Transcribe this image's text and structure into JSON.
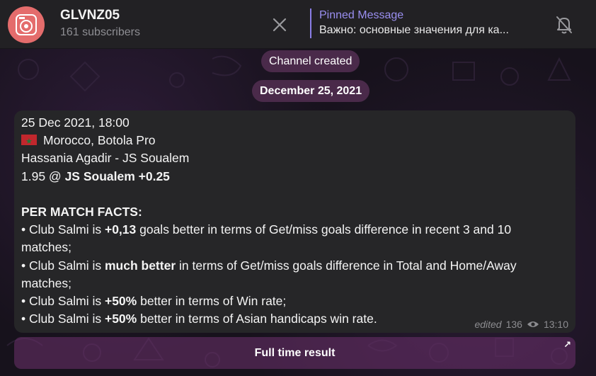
{
  "header": {
    "channel_name": "GLVNZ05",
    "subscribers": "161 subscribers",
    "pinned_title": "Pinned Message",
    "pinned_text": "Важно: основные значения для ка..."
  },
  "service": {
    "created": "Channel created",
    "date": "December 25, 2021"
  },
  "message": {
    "line1": "25 Dec 2021, 18:00",
    "line2": "Morocco, Botola Pro",
    "line3": "Hassania Agadir - JS Soualem",
    "line4_prefix": "1.95 @ ",
    "line4_bold": "JS Soualem +0.25",
    "facts_title": "PER MATCH FACTS:",
    "f1_a": "• Club Salmi is ",
    "f1_b": "+0,13",
    "f1_c": " goals better in terms of Get/miss goals difference in recent 3 and 10",
    "f1_d": "matches;",
    "f2_a": "• Club Salmi is ",
    "f2_b": "much better",
    "f2_c": " in terms of Get/miss goals difference in Total and Home/Away",
    "f2_d": "matches;",
    "f3_a": "• Club Salmi is ",
    "f3_b": "+50%",
    "f3_c": " better in terms of Win rate;",
    "f4_a": "• Club Salmi is ",
    "f4_b": "+50%",
    "f4_c": " better in terms of Asian handicaps win rate.",
    "edited": "edited",
    "views": "136",
    "time": "13:10"
  },
  "inline_button": {
    "label": "Full time result"
  },
  "colors": {
    "accent": "#8b7ee8",
    "avatar": "#e46c6c",
    "pill": "#4a2a4a",
    "bubble": "#262628"
  }
}
